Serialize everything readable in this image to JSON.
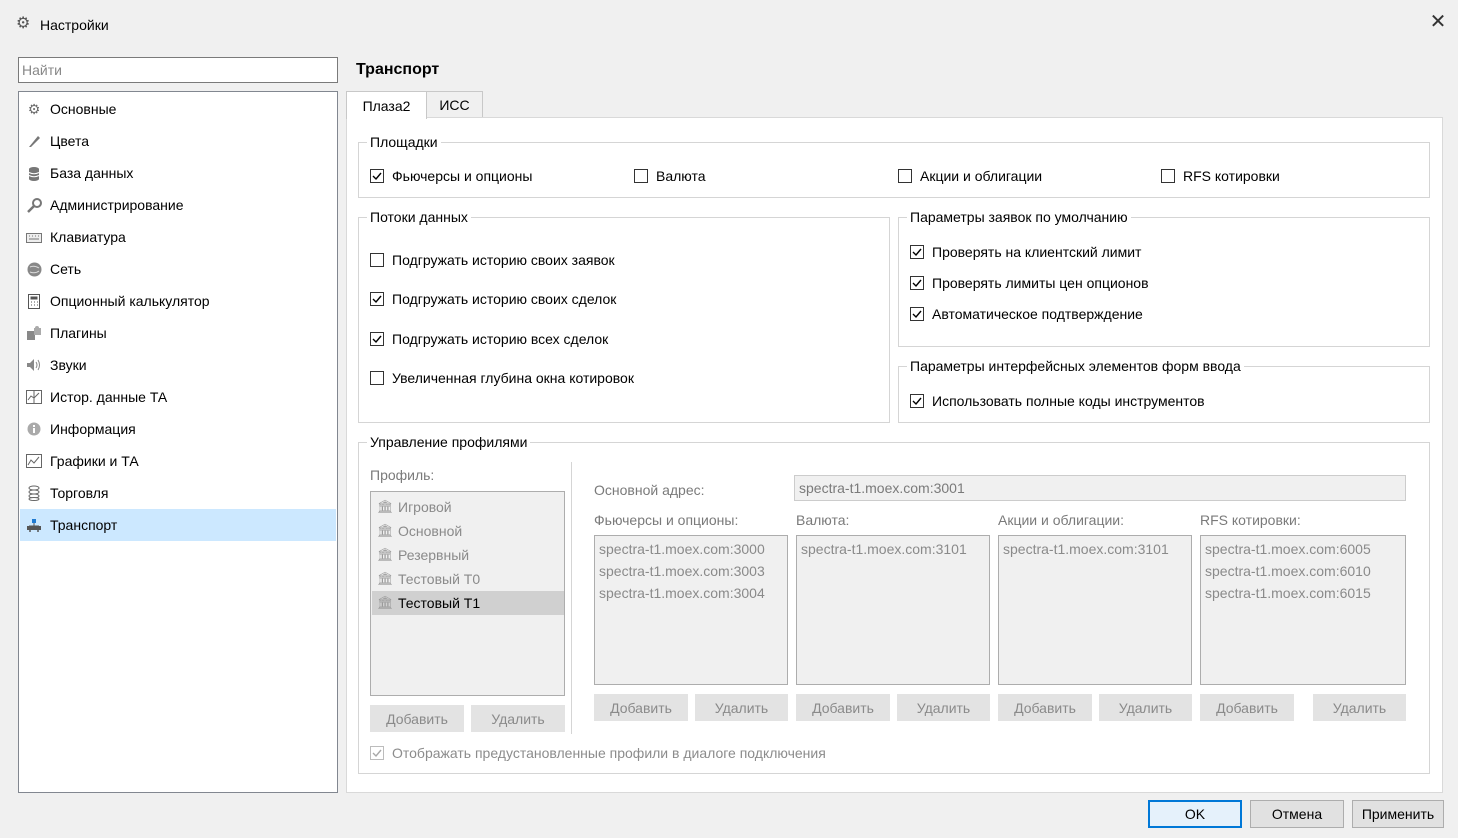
{
  "window": {
    "title": "Настройки",
    "close_icon": "close-icon"
  },
  "sidebar": {
    "search_placeholder": "Найти",
    "items": [
      {
        "label": "Основные",
        "icon": "gear-icon"
      },
      {
        "label": "Цвета",
        "icon": "brush-icon"
      },
      {
        "label": "База данных",
        "icon": "database-icon"
      },
      {
        "label": "Администрирование",
        "icon": "wrench-icon"
      },
      {
        "label": "Клавиатура",
        "icon": "keyboard-icon"
      },
      {
        "label": "Сеть",
        "icon": "network-icon"
      },
      {
        "label": "Опционный калькулятор",
        "icon": "calculator-icon"
      },
      {
        "label": "Плагины",
        "icon": "puzzle-icon"
      },
      {
        "label": "Звуки",
        "icon": "speaker-icon"
      },
      {
        "label": "Истор. данные ТА",
        "icon": "history-chart-icon"
      },
      {
        "label": "Информация",
        "icon": "info-icon"
      },
      {
        "label": "Графики и ТА",
        "icon": "line-chart-icon"
      },
      {
        "label": "Торговля",
        "icon": "coins-icon"
      },
      {
        "label": "Транспорт",
        "icon": "transport-icon"
      }
    ],
    "active_index": 13
  },
  "main": {
    "title": "Транспорт",
    "tabs": [
      {
        "label": "Плаза2"
      },
      {
        "label": "ИСС"
      }
    ],
    "active_tab": 0,
    "venues": {
      "title": "Площадки",
      "options": [
        {
          "label": "Фьючерсы и опционы",
          "checked": true
        },
        {
          "label": "Валюта",
          "checked": false
        },
        {
          "label": "Акции и облигации",
          "checked": false
        },
        {
          "label": "RFS котировки",
          "checked": false
        }
      ]
    },
    "streams": {
      "title": "Потоки данных",
      "options": [
        {
          "label": "Подгружать историю своих заявок",
          "checked": false
        },
        {
          "label": "Подгружать историю своих сделок",
          "checked": true
        },
        {
          "label": "Подгружать историю всех сделок",
          "checked": true
        },
        {
          "label": "Увеличенная глубина окна котировок",
          "checked": false
        }
      ]
    },
    "order_defaults": {
      "title": "Параметры заявок по умолчанию",
      "options": [
        {
          "label": "Проверять на клиентский лимит",
          "checked": true
        },
        {
          "label": "Проверять лимиты цен опционов",
          "checked": true
        },
        {
          "label": "Автоматическое подтверждение",
          "checked": true
        }
      ]
    },
    "ui_params": {
      "title": "Параметры интерфейсных элементов форм ввода",
      "options": [
        {
          "label": "Использовать полные коды инструментов",
          "checked": true
        }
      ]
    },
    "profiles": {
      "title": "Управление профилями",
      "profile_label": "Профиль:",
      "list": [
        "Игровой",
        "Основной",
        "Резервный",
        "Тестовый Т0",
        "Тестовый Т1"
      ],
      "selected_index": 4,
      "add_label": "Добавить",
      "delete_label": "Удалить",
      "main_address_label": "Основной адрес:",
      "main_address_value": "spectra-t1.moex.com:3001",
      "columns": [
        {
          "label": "Фьючерсы и опционы:",
          "items": [
            "spectra-t1.moex.com:3000",
            "spectra-t1.moex.com:3003",
            "spectra-t1.moex.com:3004"
          ]
        },
        {
          "label": "Валюта:",
          "items": [
            "spectra-t1.moex.com:3101"
          ]
        },
        {
          "label": "Акции и облигации:",
          "items": [
            "spectra-t1.moex.com:3101"
          ]
        },
        {
          "label": "RFS котировки:",
          "items": [
            "spectra-t1.moex.com:6005",
            "spectra-t1.moex.com:6010",
            "spectra-t1.moex.com:6015"
          ]
        }
      ],
      "show_predefined": {
        "label": "Отображать предустановленные профили в диалоге подключения",
        "checked": true
      }
    }
  },
  "footer": {
    "ok_label": "OK",
    "cancel_label": "Отмена",
    "apply_label": "Применить"
  },
  "colors": {
    "selection": "#cce8ff",
    "primary_border": "#0078d7"
  }
}
